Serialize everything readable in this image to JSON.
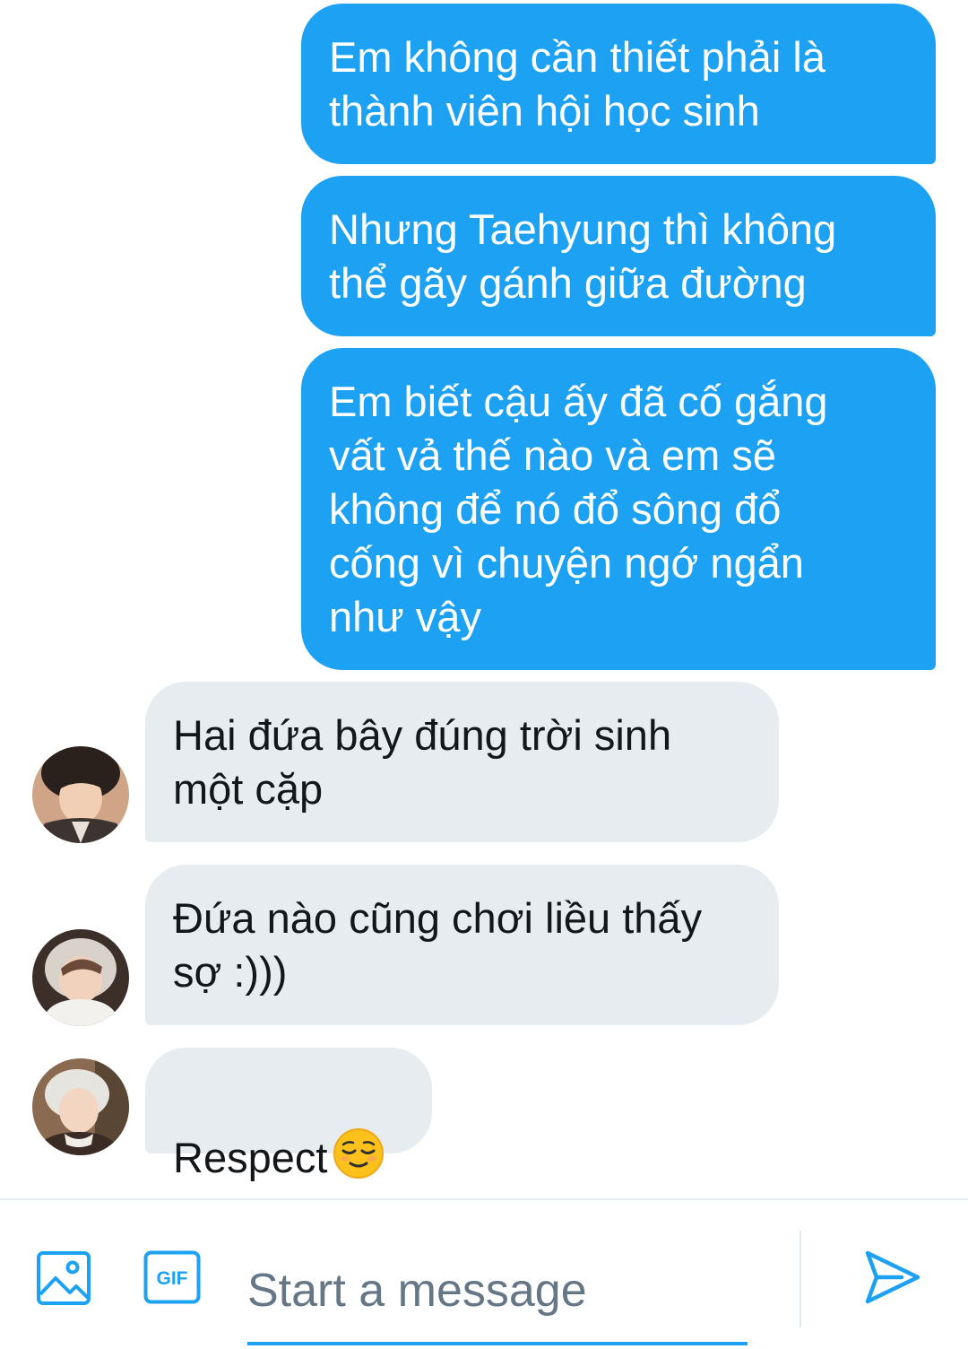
{
  "conversation": {
    "messages": [
      {
        "direction": "sent",
        "text": "Em không cần thiết phải là\nthành viên hội học sinh"
      },
      {
        "direction": "sent",
        "text": "Nhưng Taehyung thì không\nthể gãy gánh giữa đường"
      },
      {
        "direction": "sent",
        "text": "Em biết cậu ấy đã cố gắng\nvất vả thế nào và em sẽ\nkhông để nó đổ sông đổ\ncống vì chuyện ngớ ngẩn\nnhư vậy"
      },
      {
        "direction": "received",
        "text": "Hai đứa bây đúng trời sinh\nmột cặp"
      },
      {
        "direction": "received",
        "text": "Đứa nào cũng chơi liều thấy\nsợ :)))"
      },
      {
        "direction": "received",
        "text": "Respect",
        "emoji": "relieved-face-emoji"
      }
    ]
  },
  "composer": {
    "placeholder": "Start a message",
    "gif_label": "GIF",
    "icons": [
      "image-icon",
      "gif-icon",
      "send-icon"
    ]
  },
  "colors": {
    "accent": "#1da1f2",
    "received_bubble": "#e6ecf0",
    "placeholder": "#657786"
  }
}
